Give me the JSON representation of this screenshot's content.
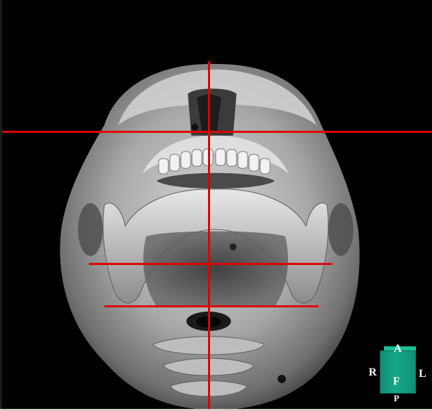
{
  "viewer": {
    "description_icon": "skull-3d-render"
  },
  "orientation_cube": {
    "top": "A",
    "front": "F",
    "bottom": "P",
    "left": "R",
    "right": "L",
    "color": "#16a886"
  },
  "crosshair": {
    "color": "#e00000"
  }
}
